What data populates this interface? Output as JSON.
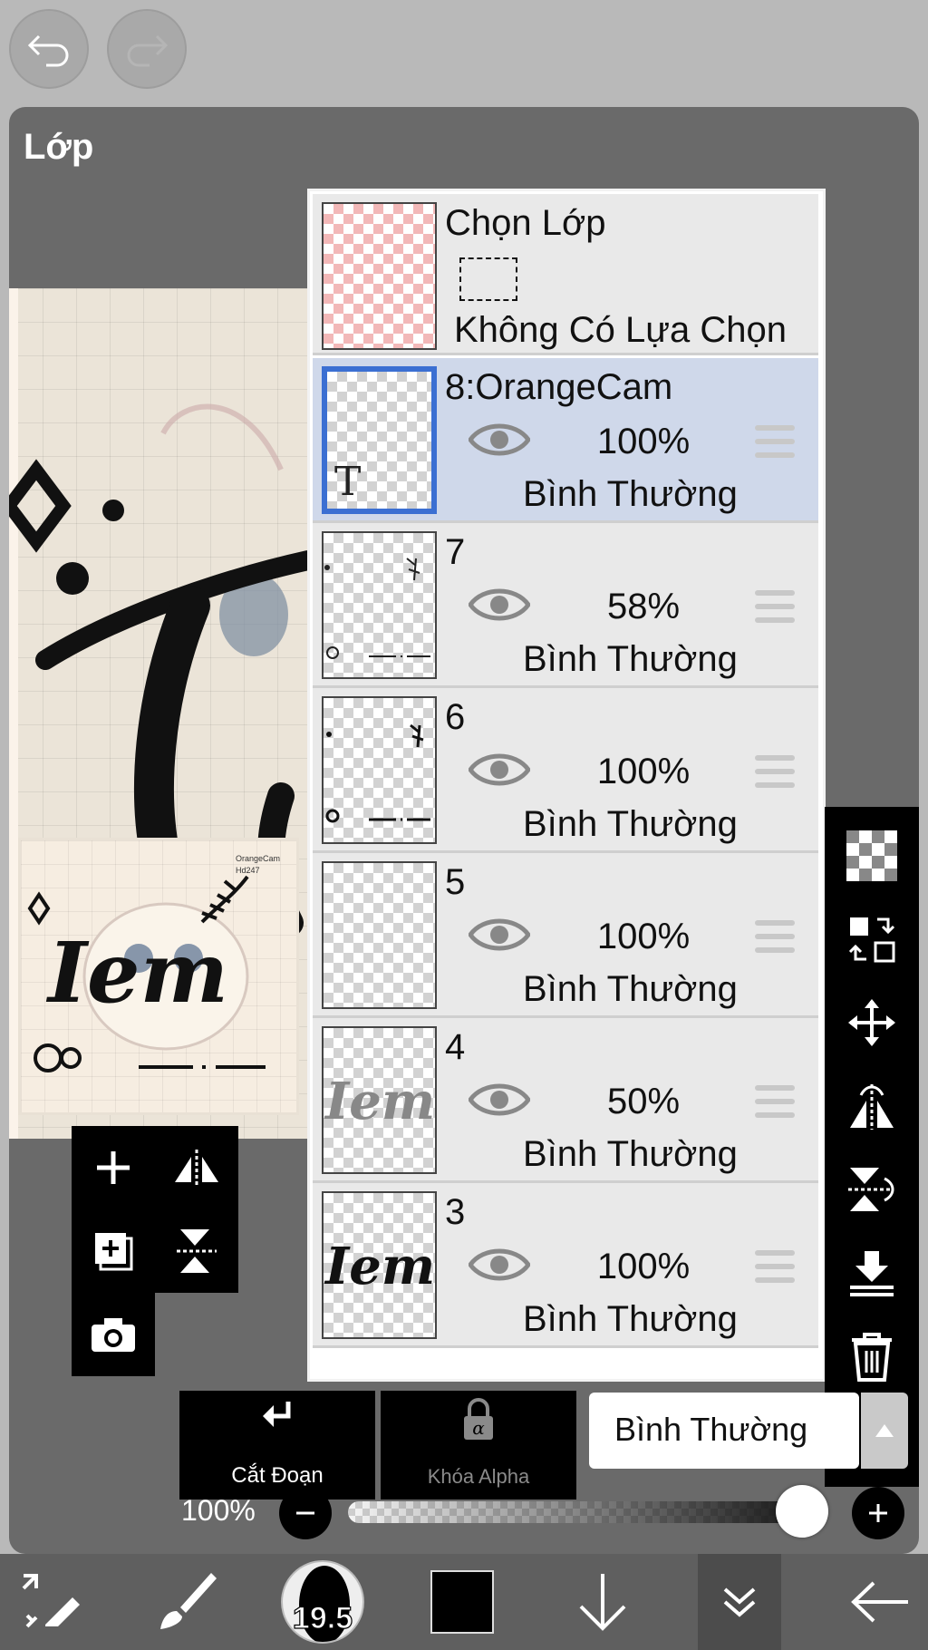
{
  "panel": {
    "title": "Lớp"
  },
  "preview": {
    "watermark_line1": "OrangeCam",
    "watermark_line2": "Hd247",
    "art_text": "Iem"
  },
  "selection_layer": {
    "title": "Chọn Lớp",
    "status": "Không Có Lựa Chọn"
  },
  "layers": [
    {
      "name": "8:OrangeCam",
      "opacity": "100%",
      "blend_mode": "Bình Thường",
      "selected": true
    },
    {
      "name": "7",
      "opacity": "58%",
      "blend_mode": "Bình Thường",
      "selected": false
    },
    {
      "name": "6",
      "opacity": "100%",
      "blend_mode": "Bình Thường",
      "selected": false
    },
    {
      "name": "5",
      "opacity": "100%",
      "blend_mode": "Bình Thường",
      "selected": false
    },
    {
      "name": "4",
      "opacity": "50%",
      "blend_mode": "Bình Thường",
      "selected": false
    },
    {
      "name": "3",
      "opacity": "100%",
      "blend_mode": "Bình Thường",
      "selected": false
    }
  ],
  "controls": {
    "clipping_label": "Cắt Đoạn",
    "alpha_lock_label": "Khóa Alpha",
    "blend_mode_value": "Bình Thường",
    "layer_opacity_label": "100%",
    "layer_opacity_value": 1.0
  },
  "toolbar": {
    "brush_size": "19.5"
  },
  "colors": {
    "accent_selected": "#3b6fd2",
    "selected_row": "#cfd8ea",
    "current_color": "#000000"
  }
}
